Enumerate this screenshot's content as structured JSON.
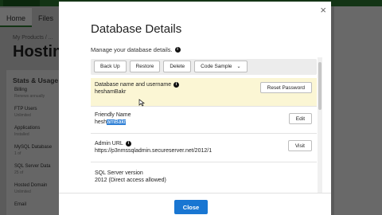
{
  "background": {
    "tabs": [
      "Home",
      "Files"
    ],
    "breadcrumb": "My Products / ...",
    "heading": "Hostin",
    "stats_heading": "Stats & Usage",
    "items": [
      {
        "label": "Billing",
        "sub": "Renews annually"
      },
      {
        "label": "FTP Users",
        "sub": "Unlimited"
      },
      {
        "label": "Applications",
        "sub": "Installed"
      },
      {
        "label": "MySQL Database",
        "sub": "1 of"
      },
      {
        "label": "SQL Server Data",
        "sub": "25 of"
      },
      {
        "label": "Hosted Domain",
        "sub": "Unlimited"
      },
      {
        "label": "Email",
        "sub": ""
      }
    ]
  },
  "modal": {
    "title": "Database Details",
    "subtitle": "Manage your database details.",
    "close_icon": "×",
    "toolbar": {
      "back_up": "Back Up",
      "restore": "Restore",
      "delete": "Delete",
      "code_sample": "Code Sample",
      "chevron": "⌄"
    },
    "db_name": {
      "label": "Database name and username",
      "value": "heshamBakr",
      "button": "Reset Password"
    },
    "friendly_name": {
      "label": "Friendly Name",
      "value_plain": "hesh",
      "value_selected": "amBakr",
      "button": "Edit"
    },
    "admin_url": {
      "label": "Admin URL",
      "value": "https://p3nmssqladmin.secureserver.net/2012/1",
      "button": "Visit"
    },
    "sql_version": {
      "label": "SQL Server version",
      "value": "2012 (Direct access allowed)"
    },
    "close_button": "Close"
  },
  "colors": {
    "accent": "#1976d2",
    "highlight_row": "#fbf6d4",
    "selection": "#2f80d6",
    "brand": "#2e7d32"
  }
}
